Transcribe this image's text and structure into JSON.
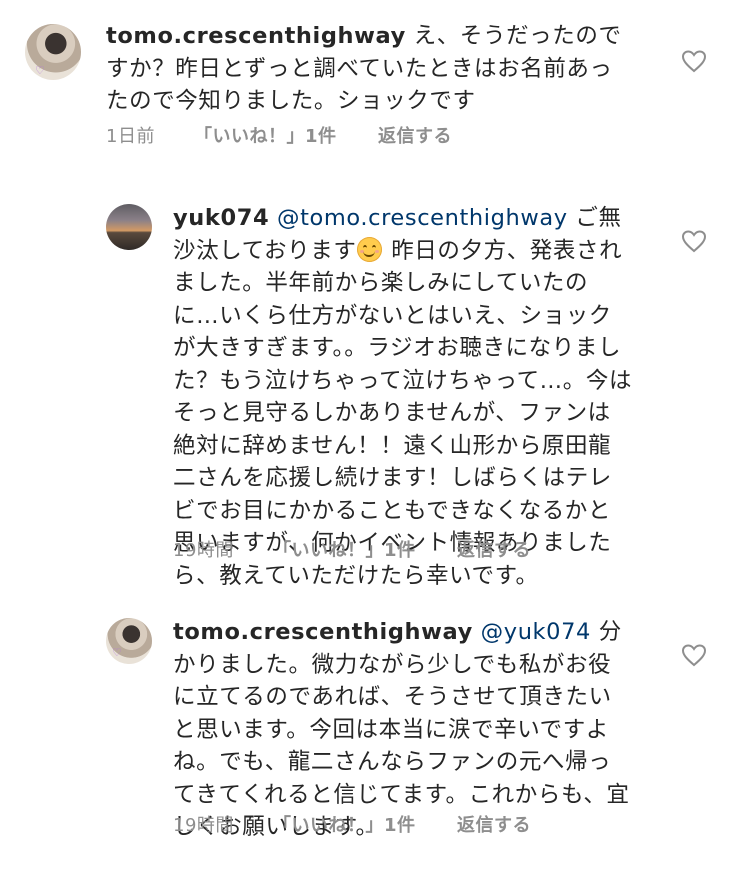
{
  "comments": [
    {
      "username": "tomo.crescenthighway",
      "mention": "",
      "text": " え、そうだったのですか？昨日とずっと調べていたときはお名前あったので今知りました。ショックです",
      "time": "1日前",
      "likes": "「いいね！」1件",
      "reply": "返信する",
      "like_icon": "heart-outline-icon"
    },
    {
      "username": "yuk074",
      "mention": " @tomo.crescenthighway",
      "text_before_emoji": " ご無沙汰しております",
      "emoji": "smiling-face-emoji",
      "text_after_emoji": " 昨日の夕方、発表されました。半年前から楽しみにしていたのに…いくら仕方がないとはいえ、ショックが大きすぎます。。ラジオお聴きになりました？もう泣けちゃって泣けちゃって…。今はそっと見守るしかありませんが、ファンは絶対に辞めません！！遠く山形から原田龍二さんを応援し続けます！しばらくはテレビでお目にかかることもできなくなるかと思いますが、何かイベント情報ありましたら、教えていただけたら幸いです。",
      "time": "19時間",
      "likes": "「いいね！」1件",
      "reply": "返信する",
      "like_icon": "heart-outline-icon"
    },
    {
      "username": "tomo.crescenthighway",
      "mention": " @yuk074",
      "text": " 分かりました。微力ながら少しでも私がお役に立てるのであれば、そうさせて頂きたいと思います。今回は本当に涙で辛いですよね。でも、龍二さんならファンの元へ帰ってきてくれると信じてます。これからも、宜しくお願いします。",
      "time": "19時間",
      "likes": "「いいね！」1件",
      "reply": "返信する",
      "like_icon": "heart-outline-icon"
    }
  ],
  "colors": {
    "text": "#262626",
    "mention": "#00376b",
    "meta": "#8e8e8e",
    "background": "#ffffff"
  }
}
